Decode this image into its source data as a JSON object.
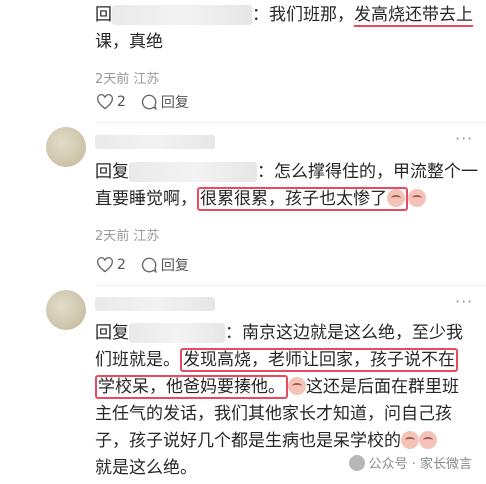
{
  "comments": [
    {
      "line1_prefix": "回",
      "line1_colon": "：我们班那，",
      "line1_highlight": "发高烧还带去上",
      "line2": "课，真绝",
      "meta": "2天前 江苏",
      "likes": "2",
      "reply_label": "回复"
    },
    {
      "reply_prefix": "回复",
      "line1_rest": "：怎么撑得住的，甲流整个一",
      "line2_prefix": "直要睡觉啊，",
      "line2_highlight": "很累很累，孩子也太惨了",
      "meta": "2天前 江苏",
      "likes": "2",
      "reply_label": "回复"
    },
    {
      "reply_prefix": "回复",
      "line1_rest": "：南京这边就是这么绝，至少我",
      "line2_prefix": "们班就是。",
      "line2_highlight": "发现高烧，老师让回家，孩子说不在",
      "line3_highlight": "学校呆，他爸妈要揍他。",
      "line3_rest": "这还是后面在群里班",
      "line4": "主任气的发话，我们其他家长才知道，问自己孩",
      "line5": "子，孩子说好几个都是生病也是呆学校的",
      "line6": "就是这么绝。"
    }
  ],
  "watermark": "公众号 · 家长微言",
  "icons": [
    "heart-icon",
    "comment-icon",
    "more-icon",
    "emoji-icon"
  ]
}
